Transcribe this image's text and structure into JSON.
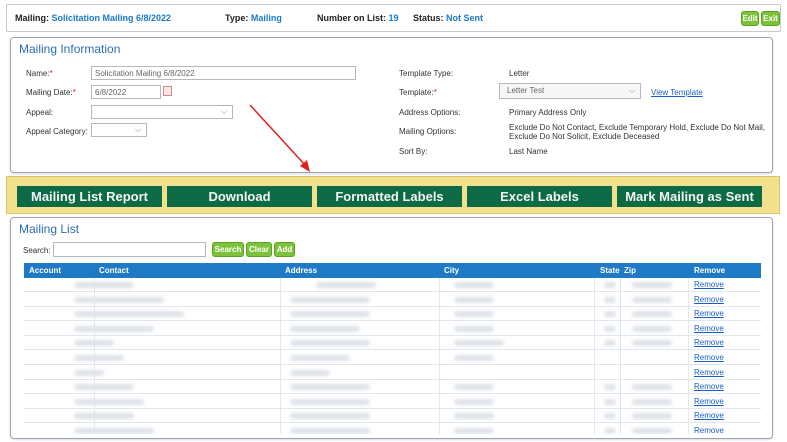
{
  "header": {
    "mailing_label": "Mailing:",
    "mailing_value": "Solicitation Mailing 6/8/2022",
    "type_label": "Type:",
    "type_value": "Mailing",
    "number_label": "Number on List:",
    "number_value": "19",
    "status_label": "Status:",
    "status_value": "Not Sent",
    "edit_label": "Edit",
    "exit_label": "Exit"
  },
  "mailing_info": {
    "title": "Mailing Information",
    "name_label": "Name:",
    "name_value": "Solicitation Mailing 6/8/2022",
    "date_label": "Mailing Date:",
    "date_value": "6/8/2022",
    "appeal_label": "Appeal:",
    "appeal_value": "",
    "appeal_category_label": "Appeal Category:",
    "appeal_category_value": "",
    "template_type_label": "Template Type:",
    "template_type_value": "Letter",
    "template_label": "Template:",
    "template_value": "Letter Test",
    "view_template_label": "View Template",
    "address_options_label": "Address Options:",
    "address_options_value": "Primary Address Only",
    "mailing_options_label": "Mailing Options:",
    "mailing_options_line1": "Exclude Do Not Contact, Exclude Temporary Hold, Exclude Do Not Mail,",
    "mailing_options_line2": "Exclude Do Not Solicit, Exclude Deceased",
    "sort_by_label": "Sort By:",
    "sort_by_value": "Last Name",
    "required_mark": "*"
  },
  "actions": {
    "mailing_list_report": "Mailing List Report",
    "download": "Download",
    "formatted_labels": "Formatted Labels",
    "excel_labels": "Excel Labels",
    "mark_as_sent": "Mark Mailing as Sent"
  },
  "mailing_list": {
    "title": "Mailing List",
    "search_label": "Search:",
    "search_value": "",
    "search_button": "Search",
    "clear_button": "Clear",
    "add_button": "Add",
    "columns": [
      "Account",
      "Contact",
      "Address",
      "City",
      "State",
      "Zip",
      "Remove"
    ],
    "remove_label": "Remove",
    "visible_row_count": 11
  },
  "colors": {
    "accent_blue": "#1a7ac8",
    "header_blue": "#1f7ac6",
    "action_green": "#0d6a47",
    "action_bar_yellow": "#f3e08c",
    "button_green": "#7cc33b",
    "status_red_arrow": "#e02020"
  }
}
